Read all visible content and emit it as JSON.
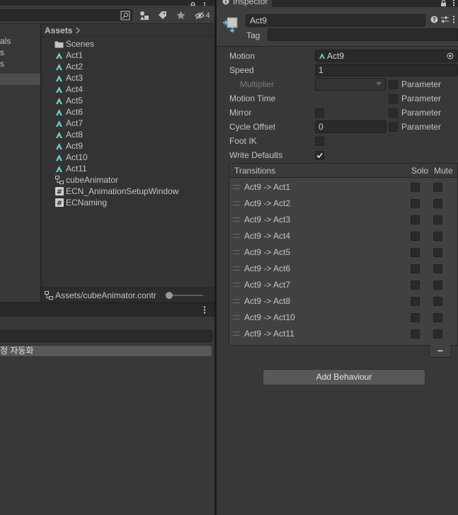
{
  "project": {
    "folders": [
      "als",
      "s",
      "s",
      ""
    ],
    "breadcrumb": "Assets",
    "assets": [
      {
        "name": "Scenes",
        "icon": "folder-icon"
      },
      {
        "name": "Act1",
        "icon": "animation-clip-icon"
      },
      {
        "name": "Act2",
        "icon": "animation-clip-icon"
      },
      {
        "name": "Act3",
        "icon": "animation-clip-icon"
      },
      {
        "name": "Act4",
        "icon": "animation-clip-icon"
      },
      {
        "name": "Act5",
        "icon": "animation-clip-icon"
      },
      {
        "name": "Act6",
        "icon": "animation-clip-icon"
      },
      {
        "name": "Act7",
        "icon": "animation-clip-icon"
      },
      {
        "name": "Act8",
        "icon": "animation-clip-icon"
      },
      {
        "name": "Act9",
        "icon": "animation-clip-icon"
      },
      {
        "name": "Act10",
        "icon": "animation-clip-icon"
      },
      {
        "name": "Act11",
        "icon": "animation-clip-icon"
      },
      {
        "name": "cubeAnimator",
        "icon": "animator-controller-icon"
      },
      {
        "name": "ECN_AnimationSetupWindow",
        "icon": "script-icon"
      },
      {
        "name": "ECNaming",
        "icon": "script-icon"
      }
    ],
    "footer_path": "Assets/cubeAnimator.contr",
    "hidden_count": "4"
  },
  "bottom_left": {
    "field_text": "정 자동화"
  },
  "inspector": {
    "tab_title": "Inspector",
    "state_name": "Act9",
    "tag_label": "Tag",
    "properties": {
      "motion_label": "Motion",
      "motion_value": "Act9",
      "speed_label": "Speed",
      "speed_value": "1",
      "multiplier_label": "Multiplier",
      "motion_time_label": "Motion Time",
      "mirror_label": "Mirror",
      "cycle_offset_label": "Cycle Offset",
      "cycle_offset_value": "0",
      "foot_ik_label": "Foot IK",
      "write_defaults_label": "Write Defaults",
      "write_defaults_checked": true,
      "parameter_label": "Parameter"
    },
    "transitions": {
      "header": "Transitions",
      "solo_label": "Solo",
      "mute_label": "Mute",
      "rows": [
        "Act9 -> Act1",
        "Act9 -> Act2",
        "Act9 -> Act3",
        "Act9 -> Act4",
        "Act9 -> Act5",
        "Act9 -> Act6",
        "Act9 -> Act7",
        "Act9 -> Act8",
        "Act9 -> Act10",
        "Act9 -> Act11"
      ],
      "remove_label": "−"
    },
    "add_behaviour_label": "Add Behaviour"
  },
  "colors": {
    "clip_icon": "#6fd4c8",
    "panel": "#383838",
    "field": "#2a2a2a"
  }
}
